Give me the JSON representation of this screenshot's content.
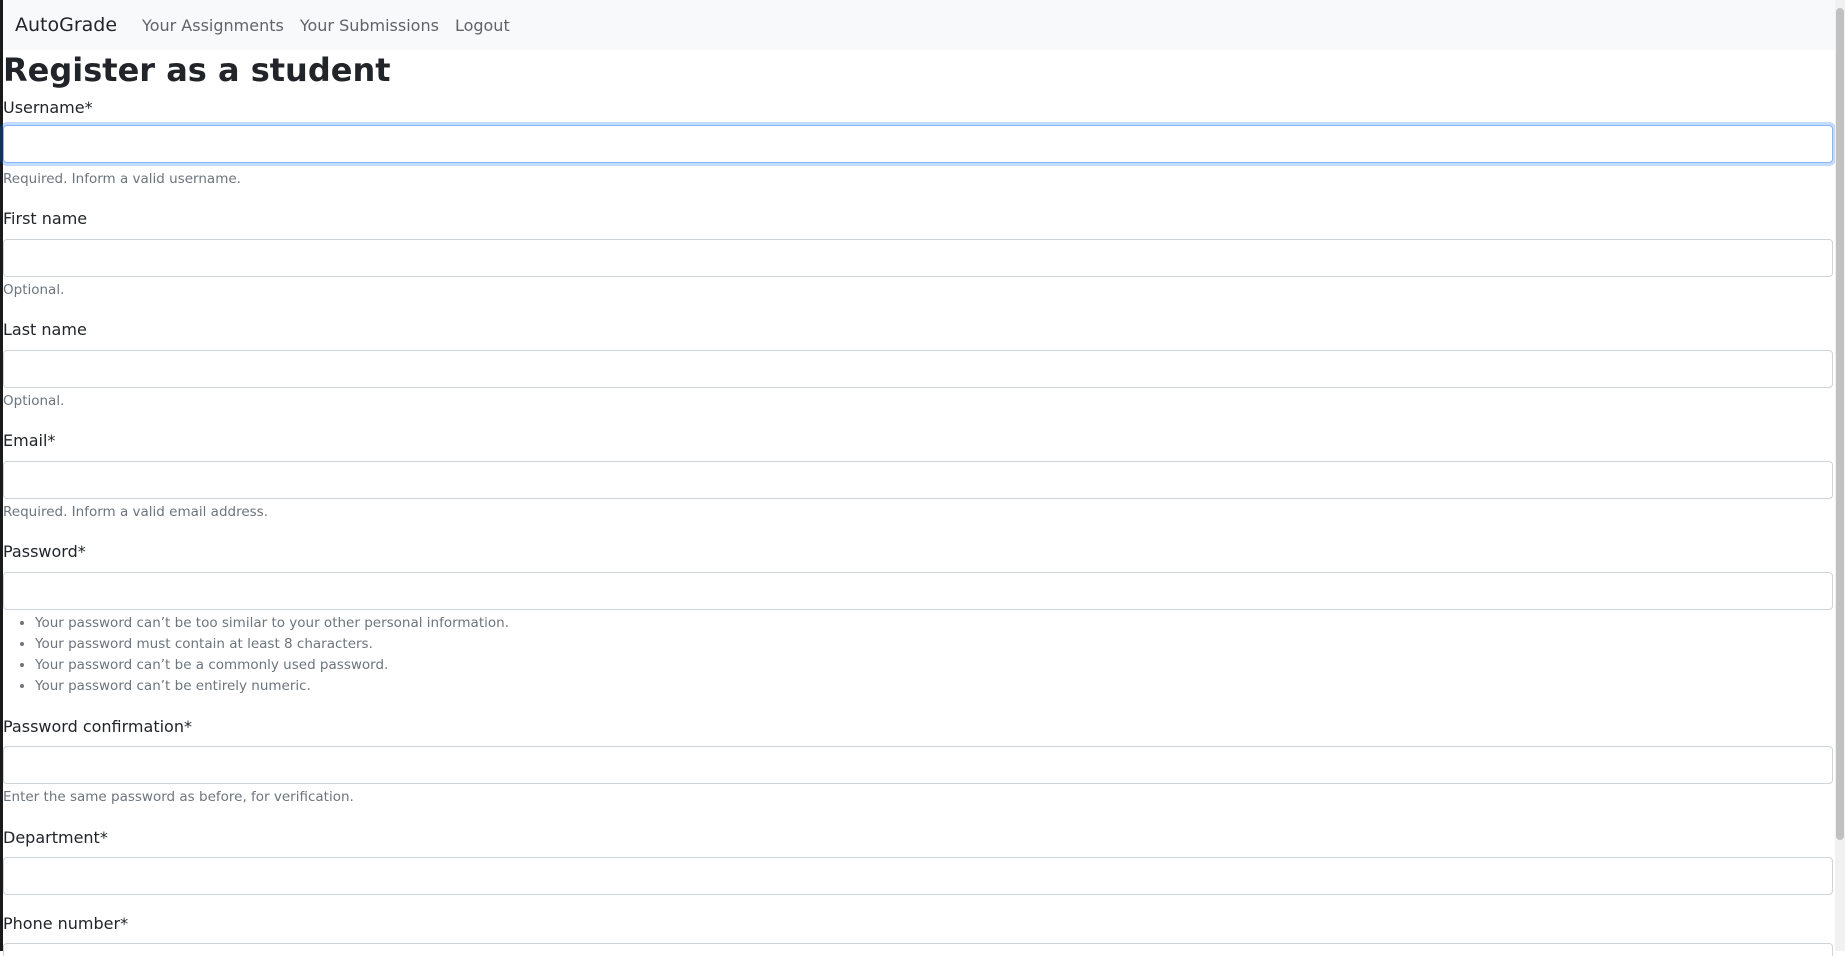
{
  "nav": {
    "brand": "AutoGrade",
    "links": [
      "Your Assignments",
      "Your Submissions",
      "Logout"
    ]
  },
  "page": {
    "title": "Register as a student"
  },
  "form": {
    "username": {
      "label": "Username*",
      "value": "",
      "help": "Required. Inform a valid username."
    },
    "first_name": {
      "label": "First name",
      "value": "",
      "help": "Optional."
    },
    "last_name": {
      "label": "Last name",
      "value": "",
      "help": "Optional."
    },
    "email": {
      "label": "Email*",
      "value": "",
      "help": "Required. Inform a valid email address."
    },
    "password": {
      "label": "Password*",
      "value": "",
      "help_items": [
        "Your password can’t be too similar to your other personal information.",
        "Your password must contain at least 8 characters.",
        "Your password can’t be a commonly used password.",
        "Your password can’t be entirely numeric."
      ]
    },
    "password_confirmation": {
      "label": "Password confirmation*",
      "value": "",
      "help": "Enter the same password as before, for verification."
    },
    "department": {
      "label": "Department*",
      "value": ""
    },
    "phone_number": {
      "label": "Phone number*"
    }
  }
}
